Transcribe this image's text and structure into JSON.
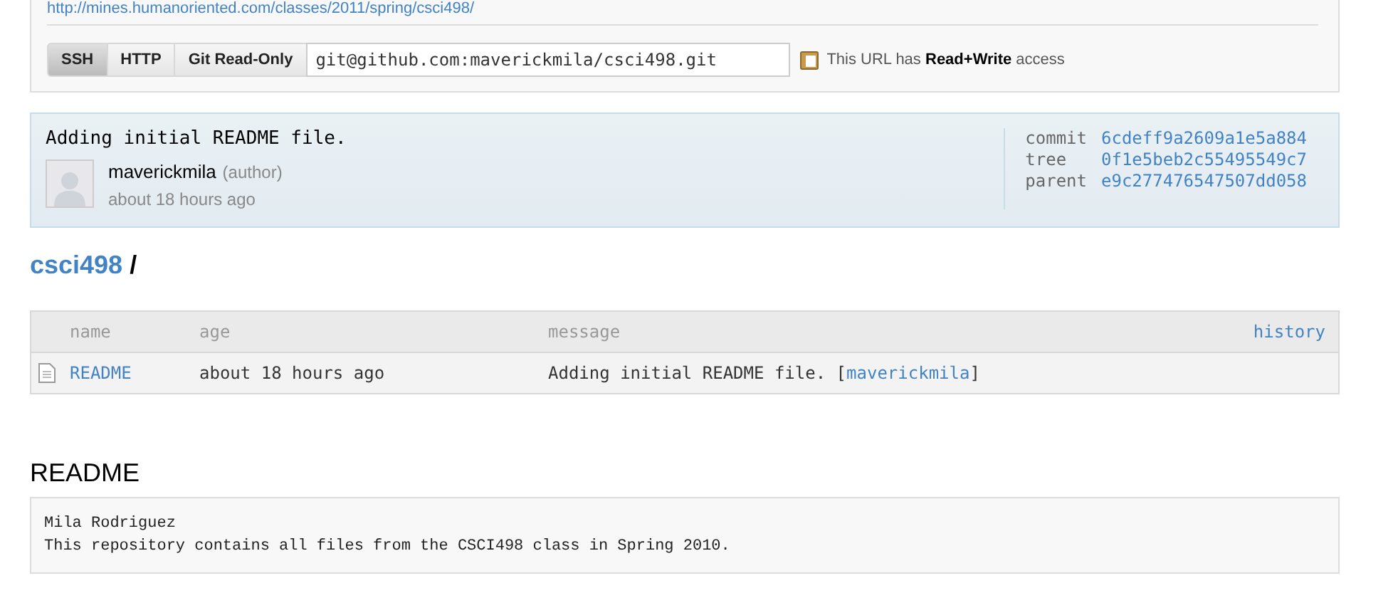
{
  "homepage_link": "http://mines.humanoriented.com/classes/2011/spring/csci498/",
  "clone": {
    "protocols": [
      {
        "label": "SSH",
        "selected": true
      },
      {
        "label": "HTTP",
        "selected": false
      },
      {
        "label": "Git Read-Only",
        "selected": false
      }
    ],
    "url": "git@github.com:maverickmila/csci498.git",
    "access_note": "This URL has **Read+Write** access"
  },
  "commit": {
    "message": "Adding initial README file.",
    "author": "maverickmila",
    "role": "(author)",
    "time": "about 18 hours ago",
    "meta": [
      {
        "label": "commit",
        "value": "6cdeff9a2609a1e5a884"
      },
      {
        "label": "tree",
        "value": "0f1e5beb2c55495549c7"
      },
      {
        "label": "parent",
        "value": "e9c277476547507dd058"
      }
    ]
  },
  "breadcrumb": {
    "repo": "csci498",
    "separator": "/"
  },
  "table": {
    "columns": [
      "name",
      "age",
      "message"
    ],
    "history_link": "history",
    "rows": [
      {
        "name": "README",
        "age": "about 18 hours ago",
        "message": "Adding initial README file. [",
        "author": "maverickmila",
        "message_end": "]"
      }
    ]
  },
  "readme": {
    "title": "README",
    "lines": [
      "Mila Rodriguez",
      "This repository contains all files from the CSCI498 class in Spring 2010."
    ]
  }
}
